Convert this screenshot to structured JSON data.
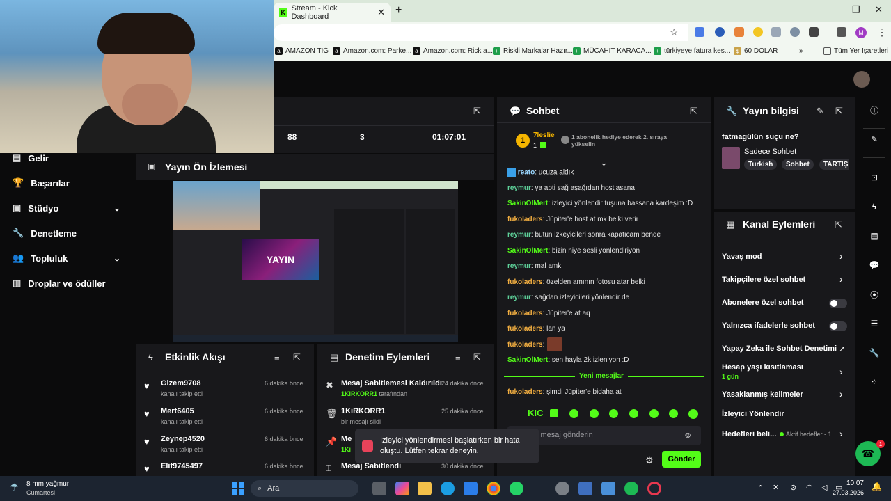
{
  "browser": {
    "tab_title": "Stream - Kick Dashboard",
    "bookmarks": [
      "AMAZON TIĞ",
      "Amazon.com: Parke...",
      "Amazon.com: Rick a...",
      "Riskli Markalar Hazır...",
      "MÜCAHİT KARACA...",
      "türkiyeye fatura kes...",
      "60 DOLAR",
      "Tüm Yer İşaretleri"
    ]
  },
  "nav": {
    "items": [
      {
        "label": "Gelir"
      },
      {
        "label": "Başarılar"
      },
      {
        "label": "Stüdyo"
      },
      {
        "label": "Denetleme"
      },
      {
        "label": "Topluluk"
      },
      {
        "label": "Droplar ve ödüller"
      }
    ]
  },
  "stats": {
    "values": [
      "88",
      "3",
      "01:07:01"
    ]
  },
  "preview": {
    "title": "Yayın Ön İzlemesi",
    "logo_text": "YAYIN"
  },
  "activity": {
    "title": "Etkinlik Akışı",
    "items": [
      {
        "name": "Gizem9708",
        "sub": "kanalı takip etti",
        "time": "6 dakika önce"
      },
      {
        "name": "Mert6405",
        "sub": "kanalı takip etti",
        "time": "6 dakika önce"
      },
      {
        "name": "Zeynep4520",
        "sub": "kanalı takip etti",
        "time": "6 dakika önce"
      },
      {
        "name": "Elif9745497",
        "sub": "",
        "time": "6 dakika önce"
      }
    ]
  },
  "modactions": {
    "title": "Denetim Eylemleri",
    "items": [
      {
        "name": "Mesaj Sabitlemesi Kaldırıldı",
        "sub_user": "1KiRKORR1",
        "sub": "tarafından",
        "time": "24 dakika önce"
      },
      {
        "name": "1KiRKORR1",
        "sub_user": "",
        "sub": "bir mesajı sildi",
        "time": "25 dakika önce"
      },
      {
        "name": "Me",
        "sub_user": "1Ki",
        "sub": "",
        "time": ""
      },
      {
        "name": "Mesaj Sabitlendi",
        "sub_user": "",
        "sub": "",
        "time": "30 dakika önce"
      }
    ]
  },
  "chat": {
    "title": "Sohbet",
    "top_gifter": {
      "name": "7leslie",
      "rank": "1",
      "count": "1"
    },
    "gift_note": "1 abonelik hediye ederek 2. sıraya yükselin",
    "messages": [
      {
        "user": "reato",
        "text": ": ucuza aldık",
        "color": "blue"
      },
      {
        "user": "reymur",
        "text": ": ya apti sağ aşağıdan hostlasana",
        "color": "teal"
      },
      {
        "user": "SakinOlMert",
        "text": ": izleyici yönlendir tuşuna bassana kardeşim :D",
        "color": "green"
      },
      {
        "user": "fukoladers",
        "text": ": Jüpiter'e host at mk belki verir",
        "color": "orange"
      },
      {
        "user": "reymur",
        "text": ": bütün izkeyicileri sonra kapatıcam bende",
        "color": "teal"
      },
      {
        "user": "SakinOlMert",
        "text": ": bizin niye sesli yönlendiriyon",
        "color": "green"
      },
      {
        "user": "reymur",
        "text": ": mal amk",
        "color": "teal"
      },
      {
        "user": "fukoladers",
        "text": ": özelden amının fotosu atar belki",
        "color": "orange"
      },
      {
        "user": "reymur",
        "text": ": sağdan izleyicileri yönlendir de",
        "color": "teal"
      },
      {
        "user": "fukoladers",
        "text": ": Jüpiter'e at aq",
        "color": "orange"
      },
      {
        "user": "fukoladers",
        "text": ": lan ya",
        "color": "orange"
      },
      {
        "user": "fukoladers",
        "text": ":",
        "color": "orange"
      },
      {
        "user": "SakinOlMert",
        "text": ": sen hayla 2k izleniyon :D",
        "color": "green"
      }
    ],
    "new_messages_label": "Yeni mesajlar",
    "after_new": {
      "user": "fukoladers",
      "text": ": şimdi Jüpiter'e bidaha at"
    },
    "input_placeholder": "Bir mesaj gönderin",
    "send_label": "Gönder"
  },
  "stream_info": {
    "title": "Yayın bilgisi",
    "stream_title": "fatmagülün suçu ne?",
    "category": "Sadece Sohbet",
    "tags": [
      "Turkish",
      "Sohbet",
      "TARTIŞ"
    ]
  },
  "channel_actions": {
    "title": "Kanal Eylemleri",
    "items": [
      {
        "label": "Yavaş mod",
        "kind": "chevron"
      },
      {
        "label": "Takipçilere özel sohbet",
        "kind": "chevron"
      },
      {
        "label": "Abonelere özel sohbet",
        "kind": "toggle"
      },
      {
        "label": "Yalnızca ifadelerle sohbet",
        "kind": "toggle"
      },
      {
        "label": "Yapay Zeka ile Sohbet Denetimi",
        "kind": "external"
      },
      {
        "label": "Hesap yaşı kısıtlaması",
        "kind": "chevron",
        "sub": "1 gün"
      },
      {
        "label": "Yasaklanmış kelimeler",
        "kind": "chevron"
      },
      {
        "label": "İzleyici Yönlendir",
        "kind": "none"
      },
      {
        "label": "Hedefleri beli...",
        "kind": "chevron",
        "badge": "Aktif hedefler - 1"
      }
    ]
  },
  "toast": {
    "text": "İzleyici yönlendirmesi başlatırken bir hata oluştu. Lütfen tekrar deneyin."
  },
  "fab_badge": "1",
  "taskbar": {
    "weather": "8 mm yağmur",
    "weather_sub": "Cumartesi",
    "search": "Ara",
    "time": "10:07",
    "date": "27.03.2026"
  },
  "colors": {
    "kick_green": "#53fc18",
    "panel": "#18181b",
    "bg": "#0b0b0c"
  }
}
